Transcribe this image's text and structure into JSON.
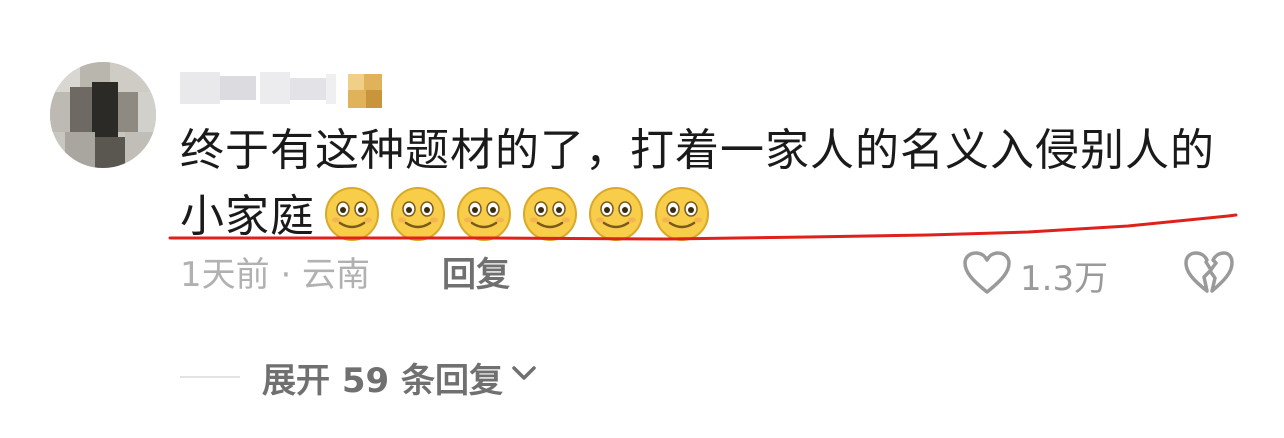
{
  "comment": {
    "text_line1": "终于有这种题材的了，打着一家人的名义入侵别人的",
    "text_line2": "小家庭",
    "emoji_icon": "smiling-face-emoji",
    "emoji_count": 6,
    "underline_color": "#e0201b"
  },
  "meta": {
    "time_location": "1天前 · 云南",
    "reply_label": "回复",
    "like_count": "1.3万"
  },
  "replies": {
    "expand_label": "展开 59 条回复"
  },
  "colors": {
    "text": "#1a1a1a",
    "muted": "#b1b1b1",
    "secondary": "#707070",
    "emoji_face": "#f7cd4a",
    "emoji_edge": "#d9a92a"
  }
}
